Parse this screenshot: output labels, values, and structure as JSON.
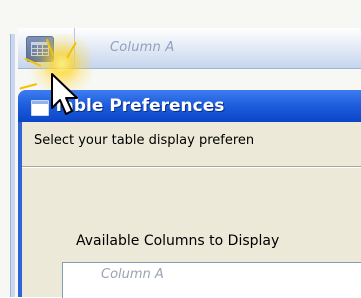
{
  "background_window": {
    "column_header_label": "Column A",
    "icon": "table-icon"
  },
  "dialog": {
    "title": "Table Preferences",
    "instructions": "Select your table display preferen",
    "section_label": "Available Columns to Display",
    "list_items": [
      "Column A"
    ],
    "icons": {
      "title": "dialog-window-icon",
      "cursor": "mouse-pointer-icon"
    }
  },
  "colors": {
    "titlebar": "#1f5fde",
    "dialog_body": "#ece9d8",
    "click_glow": "#ffd628"
  }
}
